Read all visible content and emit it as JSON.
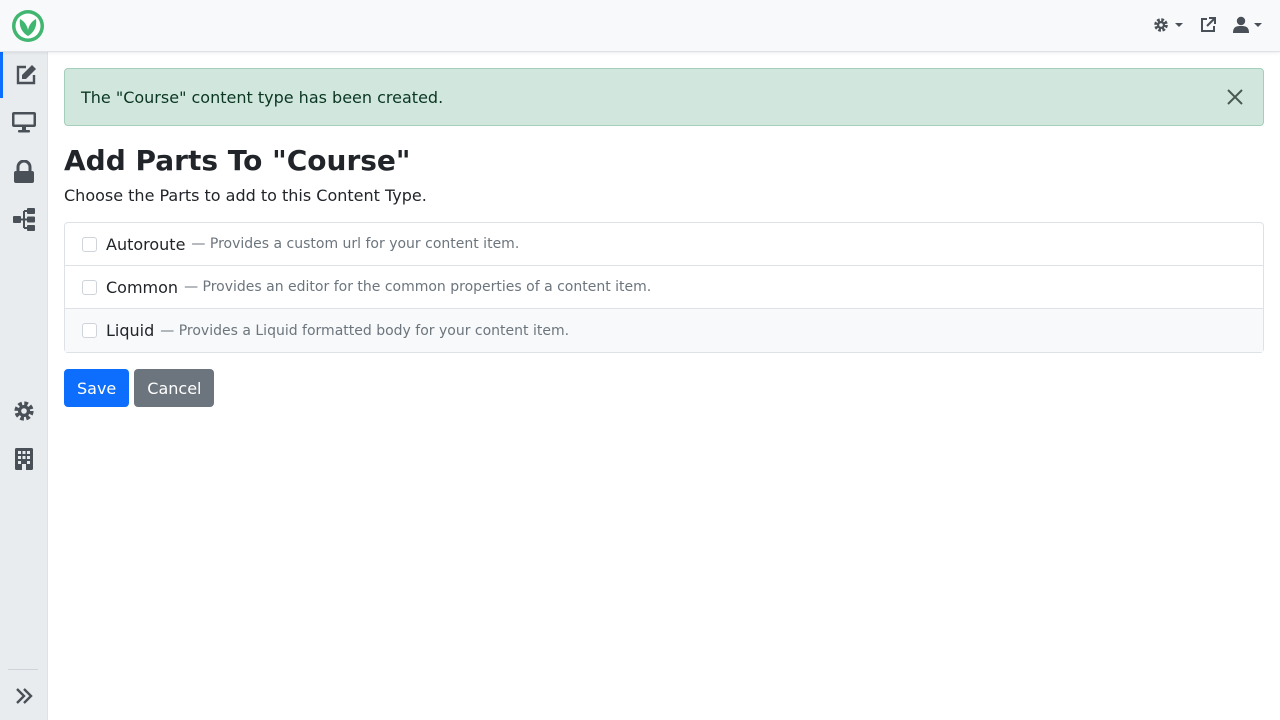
{
  "header": {
    "logo_icon": "orchard-logo-icon",
    "theme_icon": "theme-gear-icon",
    "visit_site_icon": "external-link-icon",
    "user_icon": "user-icon"
  },
  "sidebar": {
    "items": [
      {
        "name": "content",
        "icon": "edit-icon",
        "active": true
      },
      {
        "name": "design",
        "icon": "monitor-icon"
      },
      {
        "name": "security",
        "icon": "lock-icon"
      },
      {
        "name": "workflows",
        "icon": "sitemap-icon"
      },
      {
        "name": "configuration",
        "icon": "gear-icon"
      },
      {
        "name": "tenants",
        "icon": "building-icon"
      }
    ],
    "collapse_icon": "double-chevron-right-icon"
  },
  "alert": {
    "message": "The \"Course\" content type has been created.",
    "type": "success"
  },
  "page": {
    "title": "Add Parts To \"Course\"",
    "subtitle": "Choose the Parts to add to this Content Type."
  },
  "parts": [
    {
      "name": "Autoroute",
      "description": "— Provides a custom url for your content item.",
      "checked": false
    },
    {
      "name": "Common",
      "description": "— Provides an editor for the common properties of a content item.",
      "checked": false
    },
    {
      "name": "Liquid",
      "description": "— Provides a Liquid formatted body for your content item.",
      "checked": false
    }
  ],
  "actions": {
    "save_label": "Save",
    "cancel_label": "Cancel"
  },
  "colors": {
    "primary": "#0d6efd",
    "secondary": "#6c757d",
    "success_bg": "#d1e7dd",
    "success_text": "#0a3622",
    "brand_green": "#41b670"
  }
}
